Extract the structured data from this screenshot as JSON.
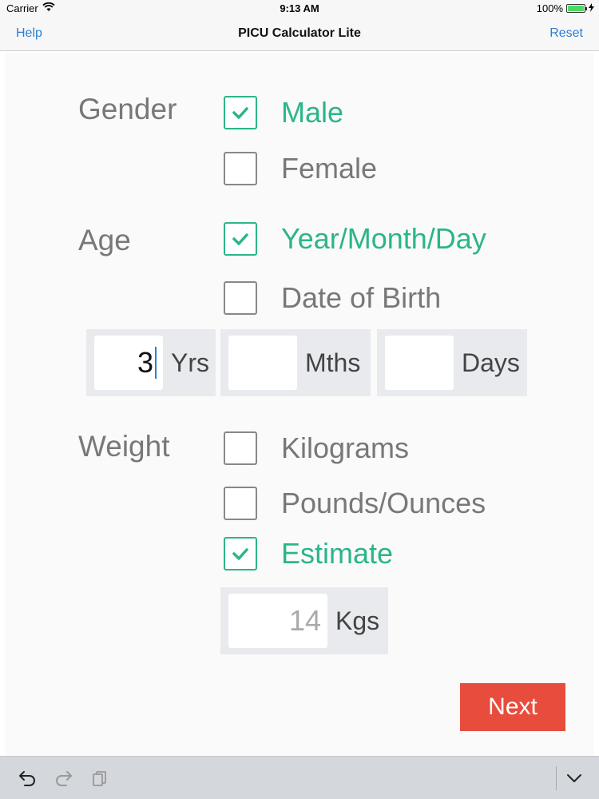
{
  "status_bar": {
    "carrier": "Carrier",
    "time": "9:13 AM",
    "battery": "100%"
  },
  "nav": {
    "left": "Help",
    "title": "PICU Calculator Lite",
    "right": "Reset"
  },
  "gender": {
    "label": "Gender",
    "options": [
      {
        "label": "Male",
        "checked": true
      },
      {
        "label": "Female",
        "checked": false
      }
    ]
  },
  "age": {
    "label": "Age",
    "options": [
      {
        "label": "Year/Month/Day",
        "checked": true
      },
      {
        "label": "Date of Birth",
        "checked": false
      }
    ],
    "fields": [
      {
        "value": "3",
        "unit": "Yrs"
      },
      {
        "value": "",
        "unit": "Mths"
      },
      {
        "value": "",
        "unit": "Days"
      }
    ]
  },
  "weight": {
    "label": "Weight",
    "options": [
      {
        "label": "Kilograms",
        "checked": false
      },
      {
        "label": "Pounds/Ounces",
        "checked": false
      },
      {
        "label": "Estimate",
        "checked": true
      }
    ],
    "estimate": {
      "value": "14",
      "unit": "Kgs"
    }
  },
  "next_label": "Next",
  "colors": {
    "accent": "#2bb58a",
    "link": "#2a7ed8",
    "next_button": "#e84c3d",
    "label": "#787878"
  },
  "toolbar": {
    "icons": [
      "undo-icon",
      "redo-icon",
      "paste-icon",
      "chevron-down-icon"
    ]
  }
}
